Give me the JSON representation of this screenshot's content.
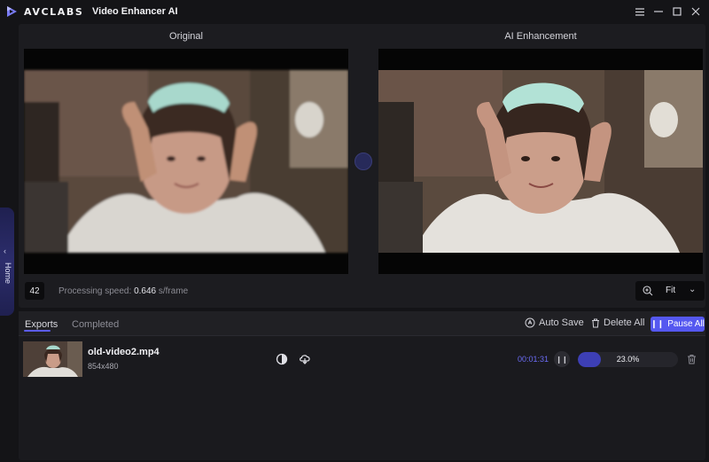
{
  "titlebar": {
    "brand": "AVCLABS",
    "app_name": "Video Enhancer AI"
  },
  "rail": {
    "home_label": "Home"
  },
  "preview": {
    "original_label": "Original",
    "enhanced_label": "AI Enhancement",
    "frame_number": "42",
    "speed_label": "Processing speed: ",
    "speed_value": "0.646",
    "speed_unit": " s/frame",
    "zoom_value": "Fit"
  },
  "exports": {
    "tabs": [
      "Exports",
      "Completed"
    ],
    "auto_save_label": "Auto Save",
    "delete_all_label": "Delete All",
    "pause_all_label": "Pause All",
    "items": [
      {
        "filename": "old-video2.mp4",
        "resolution": "854x480",
        "elapsed": "00:01:31",
        "progress_text": "23.0%",
        "progress": 0.23
      }
    ]
  },
  "colors": {
    "accent": "#5558f0",
    "progress_fill": "#3d3fb5",
    "background": "#141417"
  }
}
